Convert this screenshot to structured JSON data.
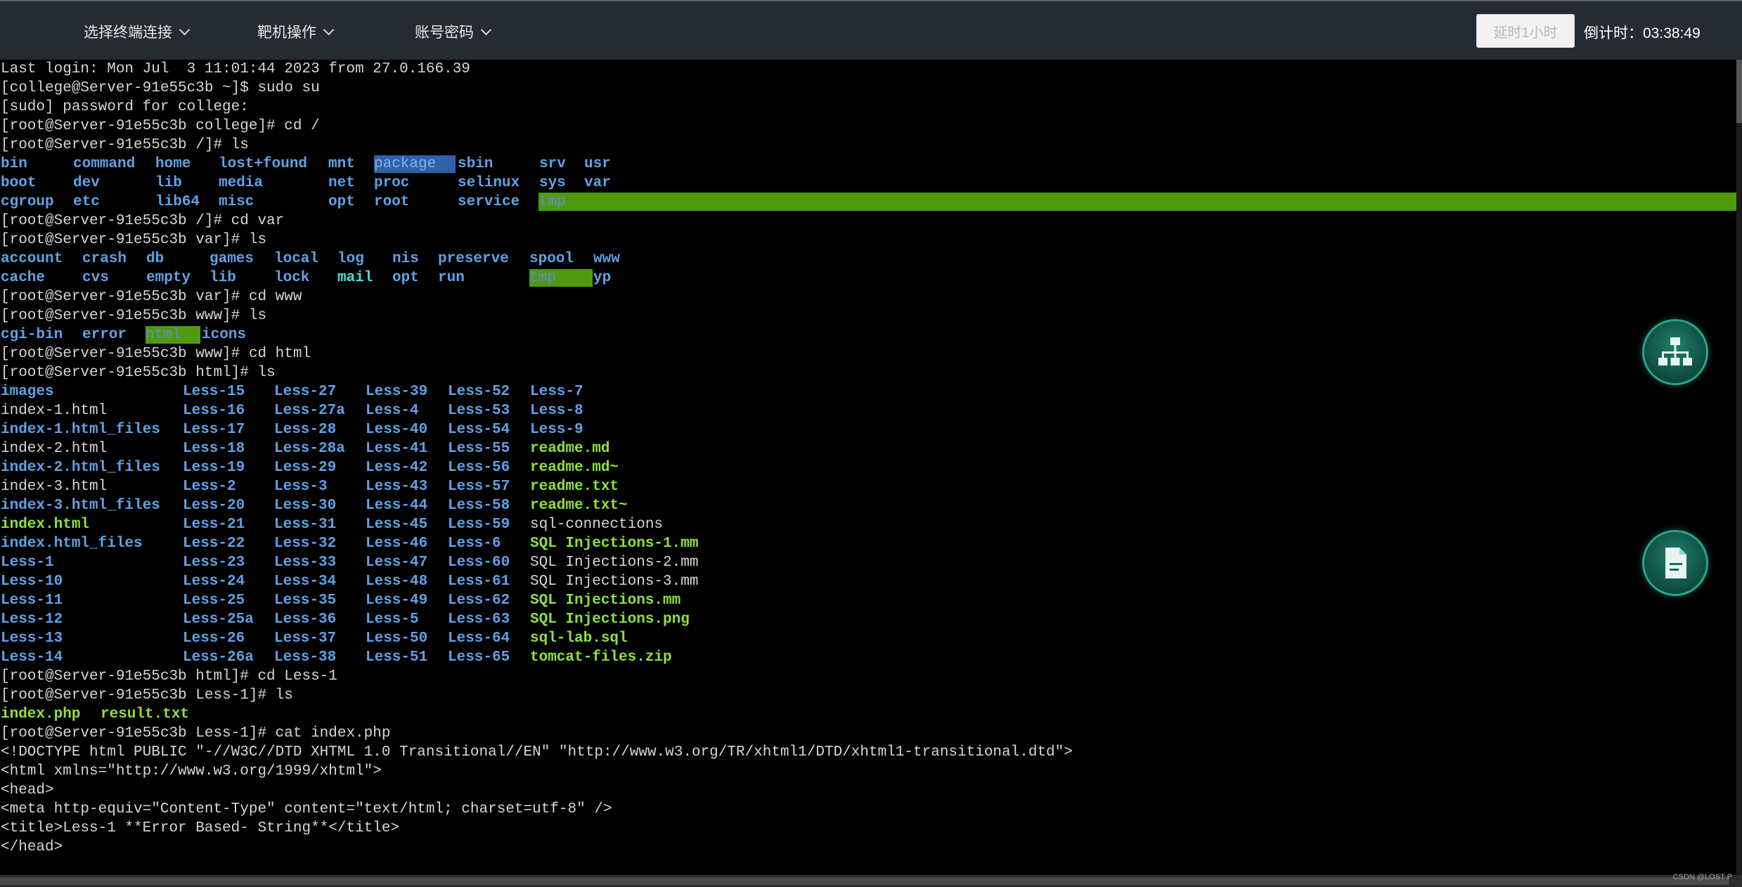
{
  "topbar": {
    "menus": [
      {
        "label": "选择终端连接"
      },
      {
        "label": "靶机操作"
      },
      {
        "label": "账号密码"
      }
    ],
    "extend_button": "延时1小时",
    "countdown": "倒计时：03:38:49"
  },
  "terminal": {
    "last_login": "Last login: Mon Jul  3 11:01:44 2023 from 27.0.166.39",
    "cmd_sudo": "[college@Server-91e55c3b ~]$ sudo su",
    "sudo_prompt": "[sudo] password for college:",
    "cmd_cd_root": "[root@Server-91e55c3b college]# cd /",
    "cmd_ls_root": "[root@Server-91e55c3b /]# ls",
    "root_listing": [
      [
        "bin",
        "command",
        "home",
        "lost+found",
        "mnt",
        "package",
        "sbin",
        "srv",
        "usr"
      ],
      [
        "boot",
        "dev",
        "lib",
        "media",
        "net",
        "proc",
        "selinux",
        "sys",
        "var"
      ],
      [
        "cgroup",
        "etc",
        "lib64",
        "misc",
        "opt",
        "root",
        "service",
        "tmp"
      ]
    ],
    "cmd_cd_var": "[root@Server-91e55c3b /]# cd var",
    "cmd_ls_var": "[root@Server-91e55c3b var]# ls",
    "var_listing": [
      [
        "account",
        "crash",
        "db",
        "games",
        "local",
        "log",
        "nis",
        "preserve",
        "spool",
        "www"
      ],
      [
        "cache",
        "cvs",
        "empty",
        "lib",
        "lock",
        "mail",
        "opt",
        "run",
        "tmp",
        "yp"
      ]
    ],
    "cmd_cd_www": "[root@Server-91e55c3b var]# cd www",
    "cmd_ls_www": "[root@Server-91e55c3b www]# ls",
    "www_listing": [
      "cgi-bin",
      "error",
      "html",
      "icons"
    ],
    "cmd_cd_html": "[root@Server-91e55c3b www]# cd html",
    "cmd_ls_html": "[root@Server-91e55c3b html]# ls",
    "html_listing": {
      "col1": [
        "images",
        "index-1.html",
        "index-1.html_files",
        "index-2.html",
        "index-2.html_files",
        "index-3.html",
        "index-3.html_files",
        "index.html",
        "index.html_files",
        "Less-1",
        "Less-10",
        "Less-11",
        "Less-12",
        "Less-13",
        "Less-14"
      ],
      "col2": [
        "Less-15",
        "Less-16",
        "Less-17",
        "Less-18",
        "Less-19",
        "Less-2",
        "Less-20",
        "Less-21",
        "Less-22",
        "Less-23",
        "Less-24",
        "Less-25",
        "Less-25a",
        "Less-26",
        "Less-26a"
      ],
      "col3": [
        "Less-27",
        "Less-27a",
        "Less-28",
        "Less-28a",
        "Less-29",
        "Less-3",
        "Less-30",
        "Less-31",
        "Less-32",
        "Less-33",
        "Less-34",
        "Less-35",
        "Less-36",
        "Less-37",
        "Less-38"
      ],
      "col4": [
        "Less-39",
        "Less-4",
        "Less-40",
        "Less-41",
        "Less-42",
        "Less-43",
        "Less-44",
        "Less-45",
        "Less-46",
        "Less-47",
        "Less-48",
        "Less-49",
        "Less-5",
        "Less-50",
        "Less-51"
      ],
      "col5": [
        "Less-52",
        "Less-53",
        "Less-54",
        "Less-55",
        "Less-56",
        "Less-57",
        "Less-58",
        "Less-59",
        "Less-6",
        "Less-60",
        "Less-61",
        "Less-62",
        "Less-63",
        "Less-64",
        "Less-65"
      ],
      "col6": [
        "Less-7",
        "Less-8",
        "Less-9",
        "readme.md",
        "readme.md~",
        "readme.txt",
        "readme.txt~",
        "sql-connections",
        "SQL Injections-1.mm",
        "SQL Injections-2.mm",
        "SQL Injections-3.mm",
        "SQL Injections.mm",
        "SQL Injections.png",
        "sql-lab.sql",
        "tomcat-files.zip"
      ]
    },
    "cmd_cd_less1": "[root@Server-91e55c3b html]# cd Less-1",
    "cmd_ls_less1": "[root@Server-91e55c3b Less-1]# ls",
    "less1_listing": [
      "index.php",
      "result.txt"
    ],
    "cmd_cat": "[root@Server-91e55c3b Less-1]# cat index.php",
    "file_lines": [
      "<!DOCTYPE html PUBLIC \"-//W3C//DTD XHTML 1.0 Transitional//EN\" \"http://www.w3.org/TR/xhtml1/DTD/xhtml1-transitional.dtd\">",
      "<html xmlns=\"http://www.w3.org/1999/xhtml\">",
      "<head>",
      "<meta http-equiv=\"Content-Type\" content=\"text/html; charset=utf-8\" />",
      "<title>Less-1 **Error Based- String**</title>",
      "</head>"
    ]
  },
  "watermark": "CSDN @LOST P",
  "icons": {
    "network": "network-topology-icon",
    "document": "document-icon"
  },
  "colors": {
    "topbar_bg": "#262a31",
    "directory": "#5fa2e6",
    "executable": "#8ee23a",
    "highlight_green": "#4f9a0e",
    "highlight_blue": "#2e62a7"
  }
}
